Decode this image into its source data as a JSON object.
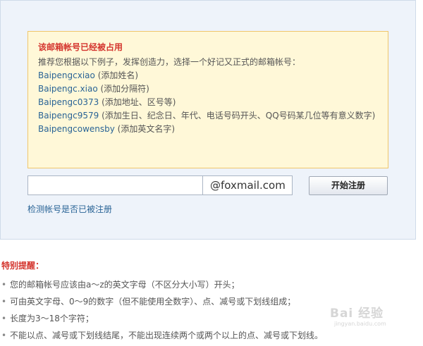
{
  "notice": {
    "title": "该邮箱帐号已经被占用",
    "intro": "推荐您根据以下例子，发挥创造力，选择一个好记又正式的邮箱帐号：",
    "suggestions": [
      {
        "name": "Baipengcxiao",
        "hint": " (添加姓名)"
      },
      {
        "name": "Baipengc.xiao",
        "hint": " (添加分隔符)"
      },
      {
        "name": "Baipengc0373",
        "hint": " (添加地址、区号等)"
      },
      {
        "name": "Baipengc9579",
        "hint": " (添加生日、纪念日、年代、电话号码开头、QQ号码某几位等有意义数字)"
      },
      {
        "name": "Baipengcowensby",
        "hint": " (添加英文名字)"
      }
    ]
  },
  "form": {
    "email_value": "",
    "domain": "@foxmail.com",
    "register_label": "开始注册",
    "check_link": "检测帐号是否已被注册"
  },
  "tips": {
    "title": "特别提醒：",
    "items": [
      "您的邮箱帐号应该由a～z的英文字母（不区分大小写）开头；",
      "可由英文字母、0～9的数字（但不能使用全数字）、点、减号或下划线组成；",
      "长度为3～18个字符；",
      "不能以点、减号或下划线结尾，不能出现连续两个或两个以上的点、减号或下划线。"
    ]
  },
  "watermark": {
    "logo_text": "Bai 经验",
    "url": "jingyan.baidu.com"
  }
}
